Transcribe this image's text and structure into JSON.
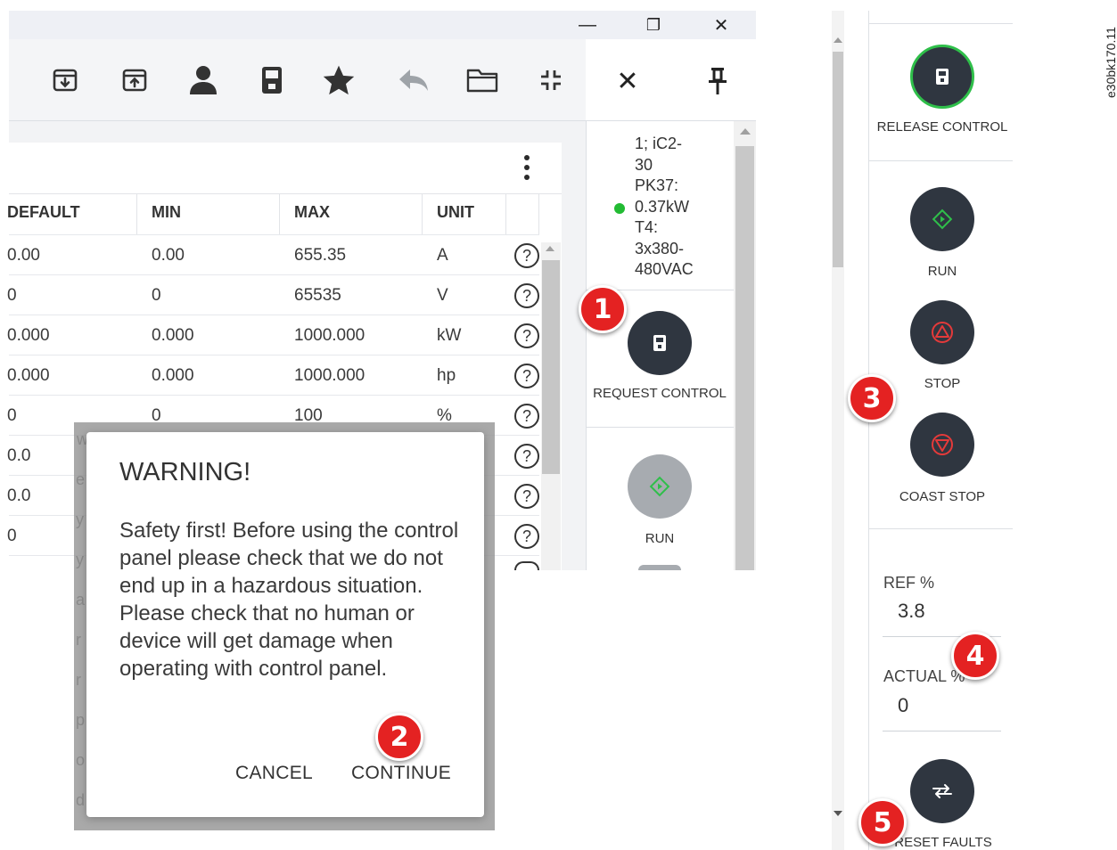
{
  "window": {
    "controls": {
      "minimize": "—",
      "restore": "❐",
      "close": "✕"
    }
  },
  "toolbar": {
    "icons": [
      "download-box-icon",
      "upload-box-icon",
      "person-icon",
      "device-icon",
      "star-icon",
      "reply-icon",
      "folder-icon",
      "collapse-icon"
    ]
  },
  "side_header": {
    "close": "✕",
    "pin": "pin-icon"
  },
  "table": {
    "columns": [
      "DEFAULT",
      "MIN",
      "MAX",
      "UNIT"
    ],
    "rows": [
      {
        "default": "0.00",
        "min": "0.00",
        "max": "655.35",
        "unit": "A"
      },
      {
        "default": "0",
        "min": "0",
        "max": "65535",
        "unit": "V"
      },
      {
        "default": "0.000",
        "min": "0.000",
        "max": "1000.000",
        "unit": "kW"
      },
      {
        "default": "0.000",
        "min": "0.000",
        "max": "1000.000",
        "unit": "hp"
      },
      {
        "default": "0",
        "min": "0",
        "max": "100",
        "unit": "%"
      },
      {
        "default": "0.0",
        "min": "",
        "max": "",
        "unit": ""
      },
      {
        "default": "0.0",
        "min": "",
        "max": "",
        "unit": ""
      },
      {
        "default": "0",
        "min": "",
        "max": "",
        "unit": ""
      }
    ],
    "help_glyph": "?"
  },
  "drive": {
    "info_lines": [
      "1; iC2-",
      "30",
      "PK37:",
      "0.37kW",
      "T4:",
      "3x380-",
      "480VAC"
    ],
    "status_color": "#22bb33"
  },
  "side_panel": {
    "request_control": "REQUEST CONTROL",
    "run": "RUN"
  },
  "modal": {
    "title": "WARNING!",
    "body": "Safety first! Before using the control panel please check that we do not end up in a hazardous situation. Please check that no human or device will get damage when operating with control panel.",
    "cancel": "CANCEL",
    "continue": "CONTINUE"
  },
  "right_panel": {
    "release_control": "RELEASE CONTROL",
    "run": "RUN",
    "stop": "STOP",
    "coast_stop": "COAST STOP",
    "ref_label": "REF %",
    "ref_value": "3.8",
    "actual_label": "ACTUAL %",
    "actual_value": "0",
    "reset_faults": "RESET FAULTS"
  },
  "badges": [
    "1",
    "2",
    "3",
    "4",
    "5"
  ],
  "figure_id": "e30bk170.11",
  "colors": {
    "button_dark": "#2f3640",
    "button_disabled": "#a7abb0",
    "run_green": "#2fbf4a",
    "stop_red": "#e43a3a",
    "badge_red": "#e42222"
  }
}
